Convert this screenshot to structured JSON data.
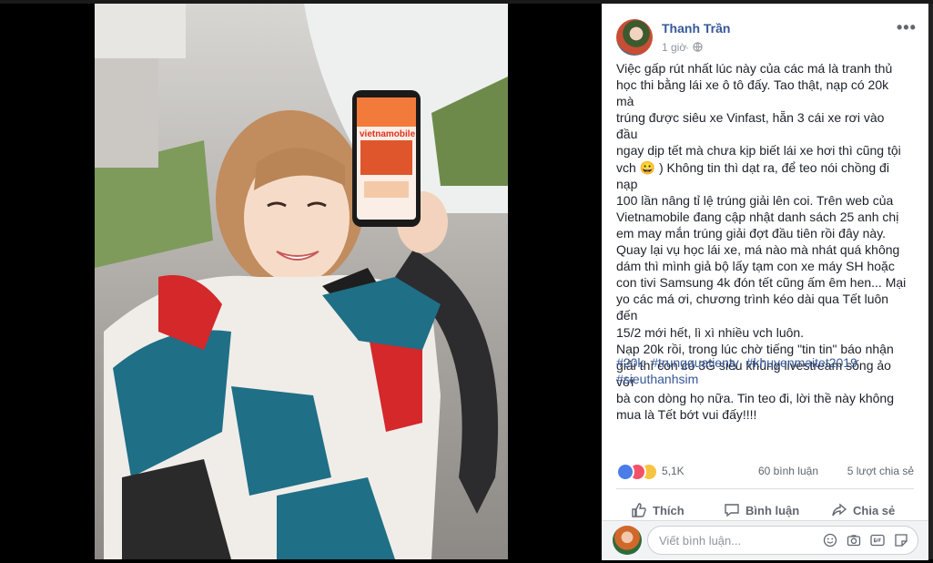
{
  "photo": {
    "brand_text": "vietnamobile",
    "alt": "photo"
  },
  "post": {
    "author": "Thanh Trần",
    "time": "1 giờ",
    "more_label": "•••",
    "text": "Việc gấp rút nhất lúc này của các má là tranh thủ\nhọc thi bằng lái xe ô tô đấy. Tao thật, nạp có 20k mà\ntrúng được siêu xe Vinfast, hẵn 3 cái xe rơi vào đầu\nngay dịp tết mà chưa kịp biết lái xe hơi thì cũng tội\nvch 😀 ) Không tin thì dạt ra, để teo nói chồng đi nạp\n100 lần nâng tỉ lệ trúng giải lên coi. Trên web của\nVietnamobile đang cập nhật danh sách 25 anh chị\nem may mắn trúng giải đợt đầu tiên rồi đây này.\nQuay lại vụ học lái xe, má nào mà nhát quá không\ndám thì mình giả bộ lấy tạm con xe máy SH hoặc\ncon tivi Samsung 4k đón tết cũng ấm êm hen... Mại\nyo các má ơi, chương trình kéo dài qua Tết luôn đến\n15/2 mới hết, lì xì nhiều vch luôn.\nNạp 20k rồi, trong lúc chờ tiếng \"tin tin\" báo nhận\ngiải thì còn có 3G siêu khủng livestream sống ảo với\nbà con dòng họ nữa. Tin teo đi, lời thề này không\nmua là Tết bớt vui đấy!!!!",
    "hashtags": [
      "#20k",
      "#trungquatienty",
      "#khuyenmaitet2019",
      "#sieuthanhsim"
    ],
    "reactions_count": "5,1K",
    "comments_count": "60 bình luận",
    "shares_count": "5 lượt chia sẻ",
    "actions": {
      "like": "Thích",
      "comment": "Bình luận",
      "share": "Chia sẻ"
    },
    "comment_placeholder": "Viết bình luận..."
  },
  "colors": {
    "link": "#365899",
    "text": "#1d2129",
    "muted": "#606770",
    "like": "#4a7de8",
    "love": "#f25268",
    "haha": "#f7c442"
  },
  "icons": [
    "globe-icon",
    "more-icon",
    "like-icon",
    "comment-icon",
    "share-icon",
    "emoji-icon",
    "camera-icon",
    "gif-icon",
    "sticker-icon"
  ]
}
